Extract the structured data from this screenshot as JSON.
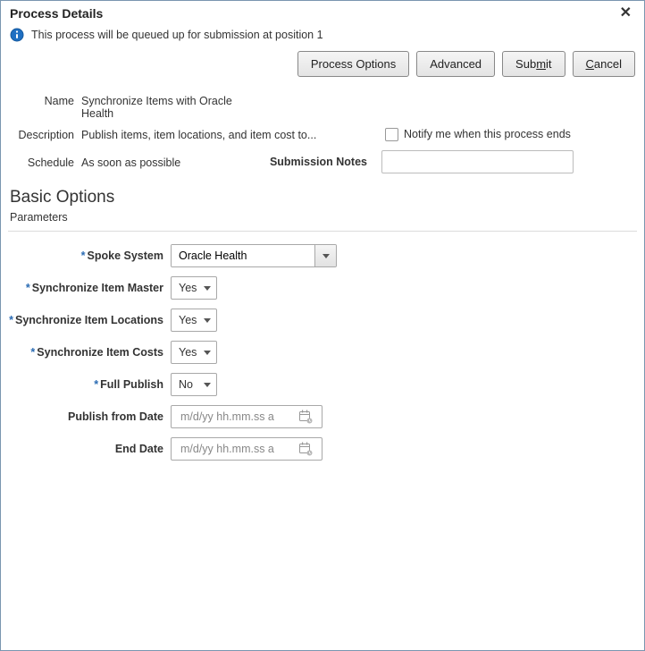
{
  "dialog": {
    "title": "Process Details",
    "info_message": "This process will be queued up for submission at position 1"
  },
  "buttons": {
    "process_options": "Process Options",
    "advanced": "Advanced",
    "submit_pre": "Sub",
    "submit_u": "m",
    "submit_post": "it",
    "cancel_u": "C",
    "cancel_post": "ancel"
  },
  "meta": {
    "name_label": "Name",
    "name_value": "Synchronize Items with Oracle Health",
    "description_label": "Description",
    "description_value": "Publish items, item locations, and item cost to...",
    "schedule_label": "Schedule",
    "schedule_value": "As soon as possible",
    "notify_label": "Notify me when this process ends",
    "submission_notes_label": "Submission Notes",
    "submission_notes_value": ""
  },
  "section": {
    "basic_options": "Basic Options",
    "parameters": "Parameters"
  },
  "params": {
    "spoke_system": {
      "label": "Spoke System",
      "value": "Oracle Health",
      "required": true
    },
    "sync_item_master": {
      "label": "Synchronize Item Master",
      "value": "Yes",
      "required": true
    },
    "sync_item_locations": {
      "label": "Synchronize Item Locations",
      "value": "Yes",
      "required": true
    },
    "sync_item_costs": {
      "label": "Synchronize Item Costs",
      "value": "Yes",
      "required": true
    },
    "full_publish": {
      "label": "Full Publish",
      "value": "No",
      "required": true
    },
    "publish_from_date": {
      "label": "Publish from Date",
      "placeholder": "m/d/yy hh.mm.ss a",
      "value": ""
    },
    "end_date": {
      "label": "End Date",
      "placeholder": "m/d/yy hh.mm.ss a",
      "value": ""
    }
  }
}
